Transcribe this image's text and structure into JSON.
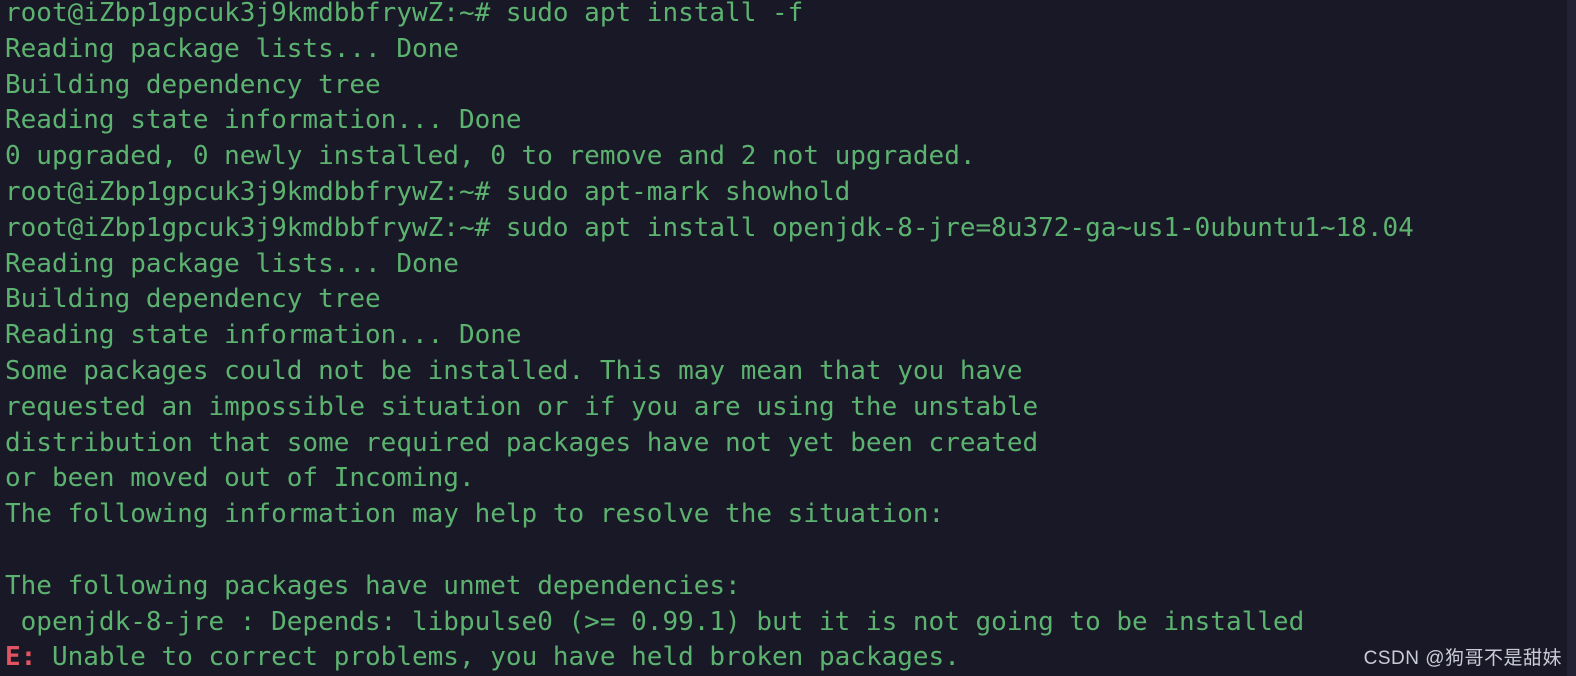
{
  "terminal": {
    "window_title": "root@iZbp1gpcuk3j9kmdbbfrywZ: ~",
    "prompt": "root@iZbp1gpcuk3j9kmdbbfrywZ:~#",
    "user": "root",
    "hostname": "iZbp1gpcuk3j9kmdbbfrywZ",
    "cwd": "~",
    "colors": {
      "background": "#191826",
      "foreground_green": "#5cb370",
      "error_red": "#e05561",
      "scrollbar": "#232134",
      "watermark": "#c9ccd6"
    },
    "lines": [
      {
        "text": "root@iZbp1gpcuk3j9kmdbbfrywZ:~# sudo apt install -f",
        "kind": "prompt"
      },
      {
        "text": "Reading package lists... Done",
        "kind": "output"
      },
      {
        "text": "Building dependency tree",
        "kind": "output"
      },
      {
        "text": "Reading state information... Done",
        "kind": "output"
      },
      {
        "text": "0 upgraded, 0 newly installed, 0 to remove and 2 not upgraded.",
        "kind": "output"
      },
      {
        "text": "root@iZbp1gpcuk3j9kmdbbfrywZ:~# sudo apt-mark showhold",
        "kind": "prompt"
      },
      {
        "text": "root@iZbp1gpcuk3j9kmdbbfrywZ:~# sudo apt install openjdk-8-jre=8u372-ga~us1-0ubuntu1~18.04",
        "kind": "prompt"
      },
      {
        "text": "Reading package lists... Done",
        "kind": "output"
      },
      {
        "text": "Building dependency tree",
        "kind": "output"
      },
      {
        "text": "Reading state information... Done",
        "kind": "output"
      },
      {
        "text": "Some packages could not be installed. This may mean that you have",
        "kind": "output"
      },
      {
        "text": "requested an impossible situation or if you are using the unstable",
        "kind": "output"
      },
      {
        "text": "distribution that some required packages have not yet been created",
        "kind": "output"
      },
      {
        "text": "or been moved out of Incoming.",
        "kind": "output"
      },
      {
        "text": "The following information may help to resolve the situation:",
        "kind": "output"
      },
      {
        "text": "",
        "kind": "blank"
      },
      {
        "text": "The following packages have unmet dependencies:",
        "kind": "output"
      },
      {
        "text": " openjdk-8-jre : Depends: libpulse0 (>= 0.99.1) but it is not going to be installed",
        "kind": "output"
      },
      {
        "text": "E: Unable to correct problems, you have held broken packages.",
        "kind": "error",
        "error_prefix": "E:",
        "error_rest": " Unable to correct problems, you have held broken packages."
      }
    ],
    "commands": [
      "sudo apt install -f",
      "sudo apt-mark showhold",
      "sudo apt install openjdk-8-jre=8u372-ga~us1-0ubuntu1~18.04"
    ]
  },
  "watermark": {
    "text": "CSDN @狗哥不是甜妹"
  }
}
